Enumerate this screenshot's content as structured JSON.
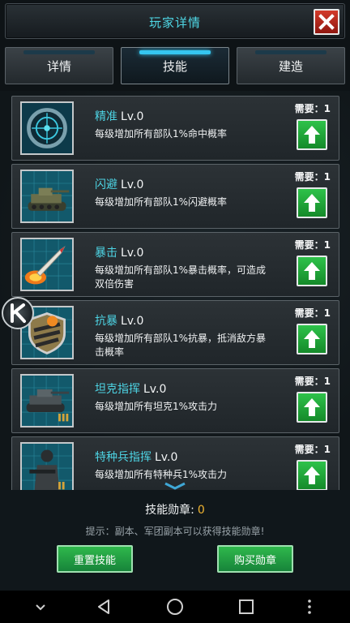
{
  "header": {
    "title": "玩家详情"
  },
  "tabs": [
    {
      "label": "详情"
    },
    {
      "label": "技能"
    },
    {
      "label": "建造"
    }
  ],
  "skills": [
    {
      "name": "精准",
      "level": "Lv.0",
      "desc": "每级增加所有部队1%命中概率",
      "need": "需要：1",
      "icon": "radar-target-icon"
    },
    {
      "name": "闪避",
      "level": "Lv.0",
      "desc": "每级增加所有部队1%闪避概率",
      "need": "需要：1",
      "icon": "tank-icon"
    },
    {
      "name": "暴击",
      "level": "Lv.0",
      "desc": "每级增加所有部队1%暴击概率，可造成双倍伤害",
      "need": "需要：1",
      "icon": "missile-icon"
    },
    {
      "name": "抗暴",
      "level": "Lv.0",
      "desc": "每级增加所有部队1%抗暴，抵消敌方暴击概率",
      "need": "需要：1",
      "icon": "shield-icon"
    },
    {
      "name": "坦克指挥",
      "level": "Lv.0",
      "desc": "每级增加所有坦克1%攻击力",
      "need": "需要：1",
      "icon": "tank-command-icon"
    },
    {
      "name": "特种兵指挥",
      "level": "Lv.0",
      "desc": "每级增加所有特种兵1%攻击力",
      "need": "需要：1",
      "icon": "soldier-icon"
    }
  ],
  "bottom": {
    "medal_label": "技能勋章:",
    "medal_count": "0",
    "hint": "提示：副本、军团副本可以获得技能勋章!",
    "reset_label": "重置技能",
    "buy_label": "购买勋章"
  },
  "colors": {
    "accent": "#4dd3e3",
    "button_green": "#2ec24a",
    "close_red": "#d33a2a",
    "medal_count": "#f0b431"
  }
}
